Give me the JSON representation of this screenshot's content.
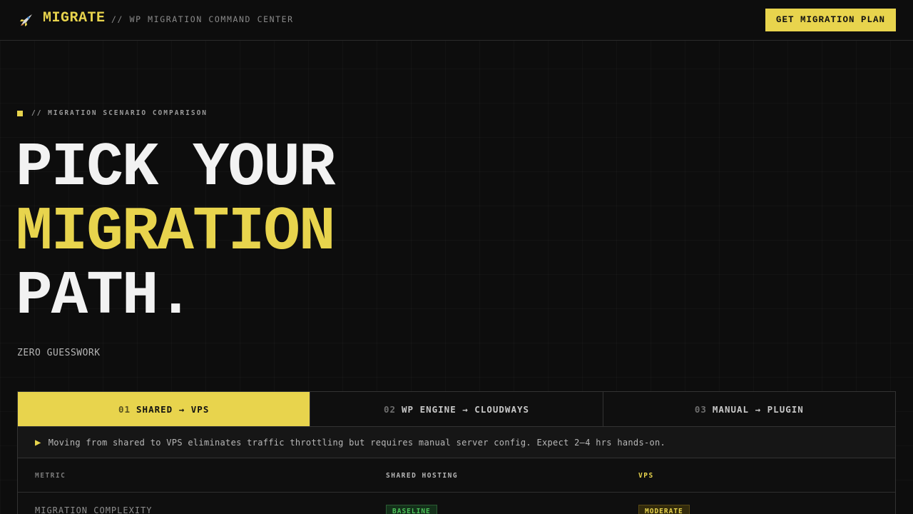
{
  "header": {
    "brand": "MIGRATE",
    "tagline": "// WP MIGRATION COMMAND CENTER",
    "brand_icon": "rocket-icon",
    "cta_label": "GET MIGRATION PLAN"
  },
  "hero": {
    "eyebrow": "// MIGRATION SCENARIO COMPARISON",
    "line1": "PICK YOUR",
    "line2": "MIGRATION",
    "line3": "PATH.",
    "subhead": "ZERO GUESSWORK"
  },
  "tabs": [
    {
      "num": "01",
      "label": "SHARED → VPS",
      "active": true
    },
    {
      "num": "02",
      "label": "WP ENGINE → CLOUDWAYS",
      "active": false
    },
    {
      "num": "03",
      "label": "MANUAL → PLUGIN",
      "active": false
    }
  ],
  "note": "Moving from shared to VPS eliminates traffic throttling but requires manual server config. Expect 2–4 hrs hands-on.",
  "table": {
    "headers": {
      "metric": "METRIC",
      "from": "SHARED HOSTING",
      "to": "VPS"
    },
    "rows": [
      {
        "metric": "MIGRATION COMPLEXITY",
        "from": "BASELINE",
        "to": "MODERATE"
      }
    ]
  },
  "colors": {
    "accent": "#e8d44d",
    "background": "#0d0d0d",
    "success": "#4cc35a"
  }
}
